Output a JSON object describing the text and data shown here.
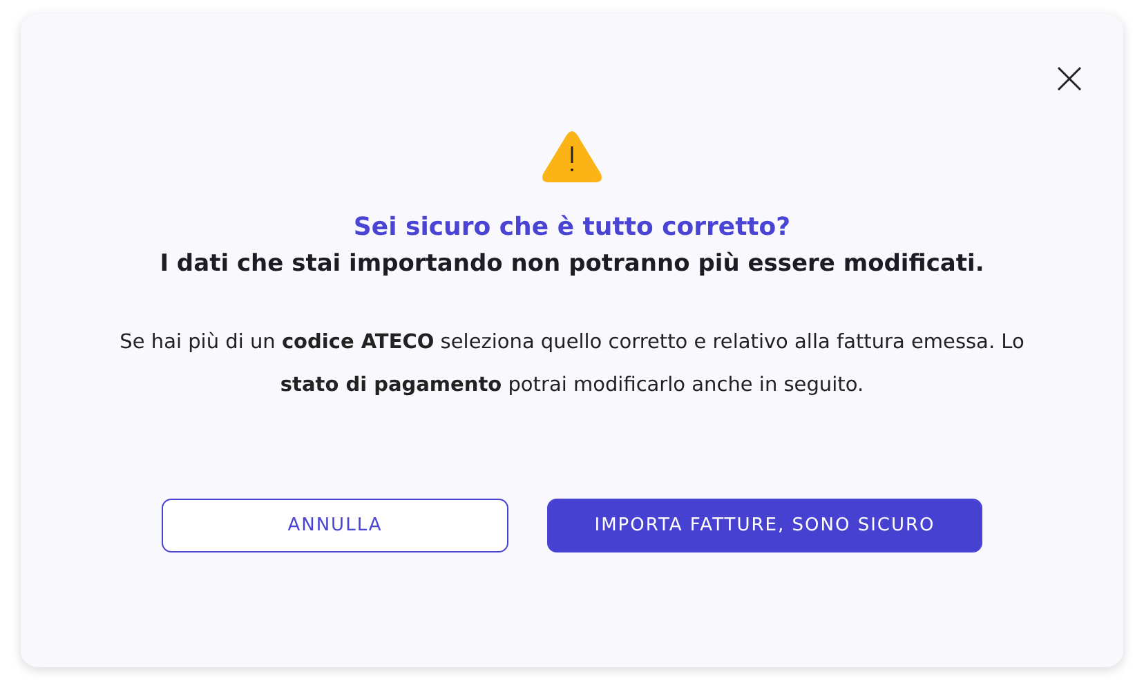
{
  "dialog": {
    "title": "Sei sicuro che è tutto corretto?",
    "subtitle": "I dati che stai importando non potranno più essere modificati.",
    "message": "Se hai più di un **codice ATECO** seleziona quello corretto e relativo alla fattura emessa. Lo **stato di pagamento** potrai modificarlo anche in seguito.",
    "buttons": [
      {
        "label": "ANNULLA",
        "kind": "secondary"
      },
      {
        "label": "IMPORTA FATTURE, SONO SICURO",
        "kind": "primary"
      }
    ]
  }
}
